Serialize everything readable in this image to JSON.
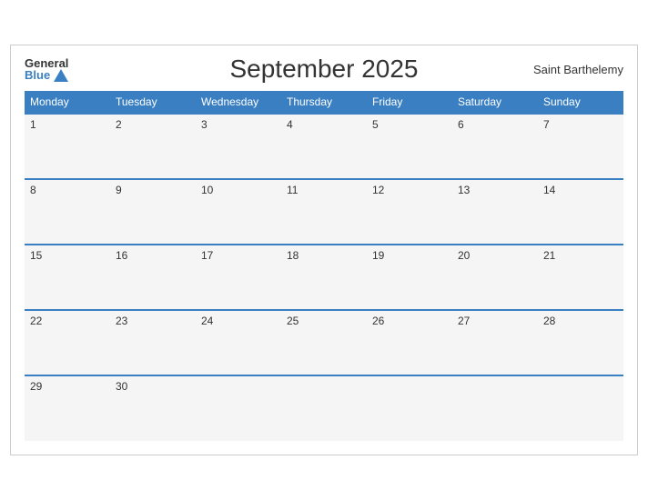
{
  "header": {
    "logo_general": "General",
    "logo_blue": "Blue",
    "title": "September 2025",
    "location": "Saint Barthelemy"
  },
  "days_of_week": [
    "Monday",
    "Tuesday",
    "Wednesday",
    "Thursday",
    "Friday",
    "Saturday",
    "Sunday"
  ],
  "weeks": [
    [
      1,
      2,
      3,
      4,
      5,
      6,
      7
    ],
    [
      8,
      9,
      10,
      11,
      12,
      13,
      14
    ],
    [
      15,
      16,
      17,
      18,
      19,
      20,
      21
    ],
    [
      22,
      23,
      24,
      25,
      26,
      27,
      28
    ],
    [
      29,
      30,
      null,
      null,
      null,
      null,
      null
    ]
  ]
}
